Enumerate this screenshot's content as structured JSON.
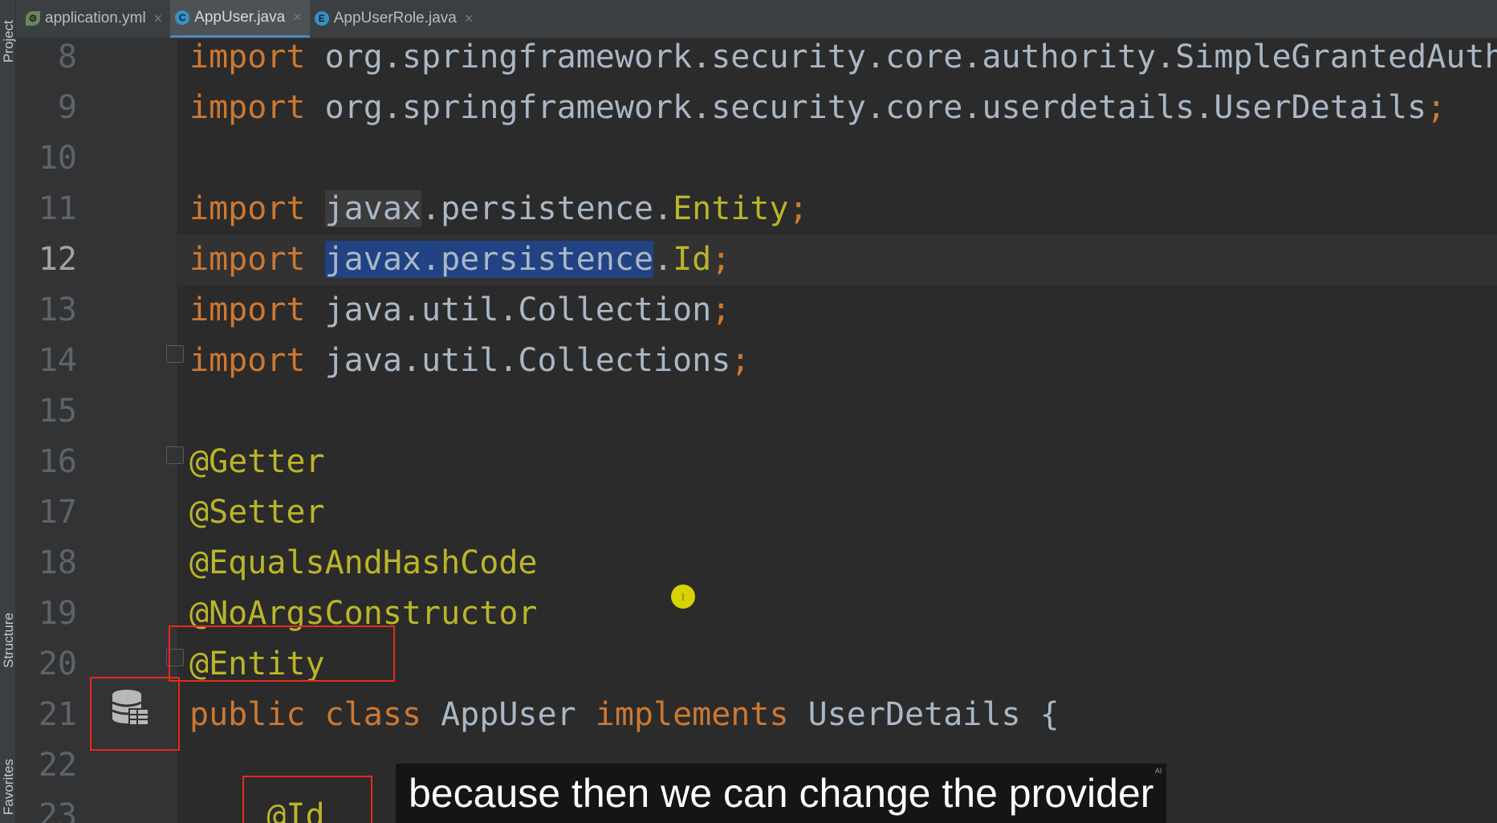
{
  "tabs": [
    {
      "label": "application.yml",
      "icon": "spring-leaf-icon",
      "active": false
    },
    {
      "label": "AppUser.java",
      "icon": "class-icon",
      "icon_letter": "C",
      "active": true
    },
    {
      "label": "AppUserRole.java",
      "icon": "enum-icon",
      "icon_letter": "E",
      "active": false
    }
  ],
  "toolstrip": {
    "project": "Project",
    "structure": "Structure",
    "favorites": "Favorites"
  },
  "editor": {
    "current_line": "12",
    "lines": [
      {
        "num": "8",
        "parts": [
          [
            "kw",
            "import"
          ],
          [
            "txt",
            " org.springframework.security.core.authority.SimpleGrantedAuthority;"
          ]
        ]
      },
      {
        "num": "9",
        "parts": [
          [
            "kw",
            "import"
          ],
          [
            "txt",
            " org.springframework.security.core.userdetails.UserDetails"
          ],
          [
            "kw",
            ";"
          ]
        ]
      },
      {
        "num": "10",
        "parts": []
      },
      {
        "num": "11",
        "parts": [
          [
            "kw",
            "import"
          ],
          [
            "txt",
            " "
          ],
          [
            "usage",
            "javax"
          ],
          [
            "txt",
            ".persistence."
          ],
          [
            "ann",
            "Entity"
          ],
          [
            "kw",
            ";"
          ]
        ]
      },
      {
        "num": "12",
        "parts": [
          [
            "kw",
            "import"
          ],
          [
            "txt",
            " "
          ],
          [
            "sel",
            "javax.persistence"
          ],
          [
            "txt",
            "."
          ],
          [
            "ann",
            "Id"
          ],
          [
            "kw",
            ";"
          ]
        ]
      },
      {
        "num": "13",
        "parts": [
          [
            "kw",
            "import"
          ],
          [
            "txt",
            " java.util.Collection"
          ],
          [
            "kw",
            ";"
          ]
        ]
      },
      {
        "num": "14",
        "parts": [
          [
            "kw",
            "import"
          ],
          [
            "txt",
            " java.util.Collections"
          ],
          [
            "kw",
            ";"
          ]
        ]
      },
      {
        "num": "15",
        "parts": []
      },
      {
        "num": "16",
        "parts": [
          [
            "ann",
            "@Getter"
          ]
        ]
      },
      {
        "num": "17",
        "parts": [
          [
            "ann",
            "@Setter"
          ]
        ]
      },
      {
        "num": "18",
        "parts": [
          [
            "ann",
            "@EqualsAndHashCode"
          ]
        ]
      },
      {
        "num": "19",
        "parts": [
          [
            "ann",
            "@NoArgsConstructor"
          ]
        ]
      },
      {
        "num": "20",
        "parts": [
          [
            "ann",
            "@Entity"
          ]
        ]
      },
      {
        "num": "21",
        "parts": [
          [
            "kw",
            "public class "
          ],
          [
            "txt",
            "AppUser "
          ],
          [
            "kw",
            "implements "
          ],
          [
            "txt",
            "UserDetails {"
          ]
        ]
      },
      {
        "num": "22",
        "parts": []
      },
      {
        "num": "23",
        "parts": [
          [
            "txt",
            "    "
          ],
          [
            "ann",
            "@Id"
          ]
        ]
      }
    ]
  },
  "caption": {
    "text": "because then we can change the provider",
    "badge": "AI"
  },
  "colors": {
    "keyword": "#cc7832",
    "annotation": "#bbb529",
    "text": "#a9b7c6",
    "highlight_box": "#e8291c"
  }
}
